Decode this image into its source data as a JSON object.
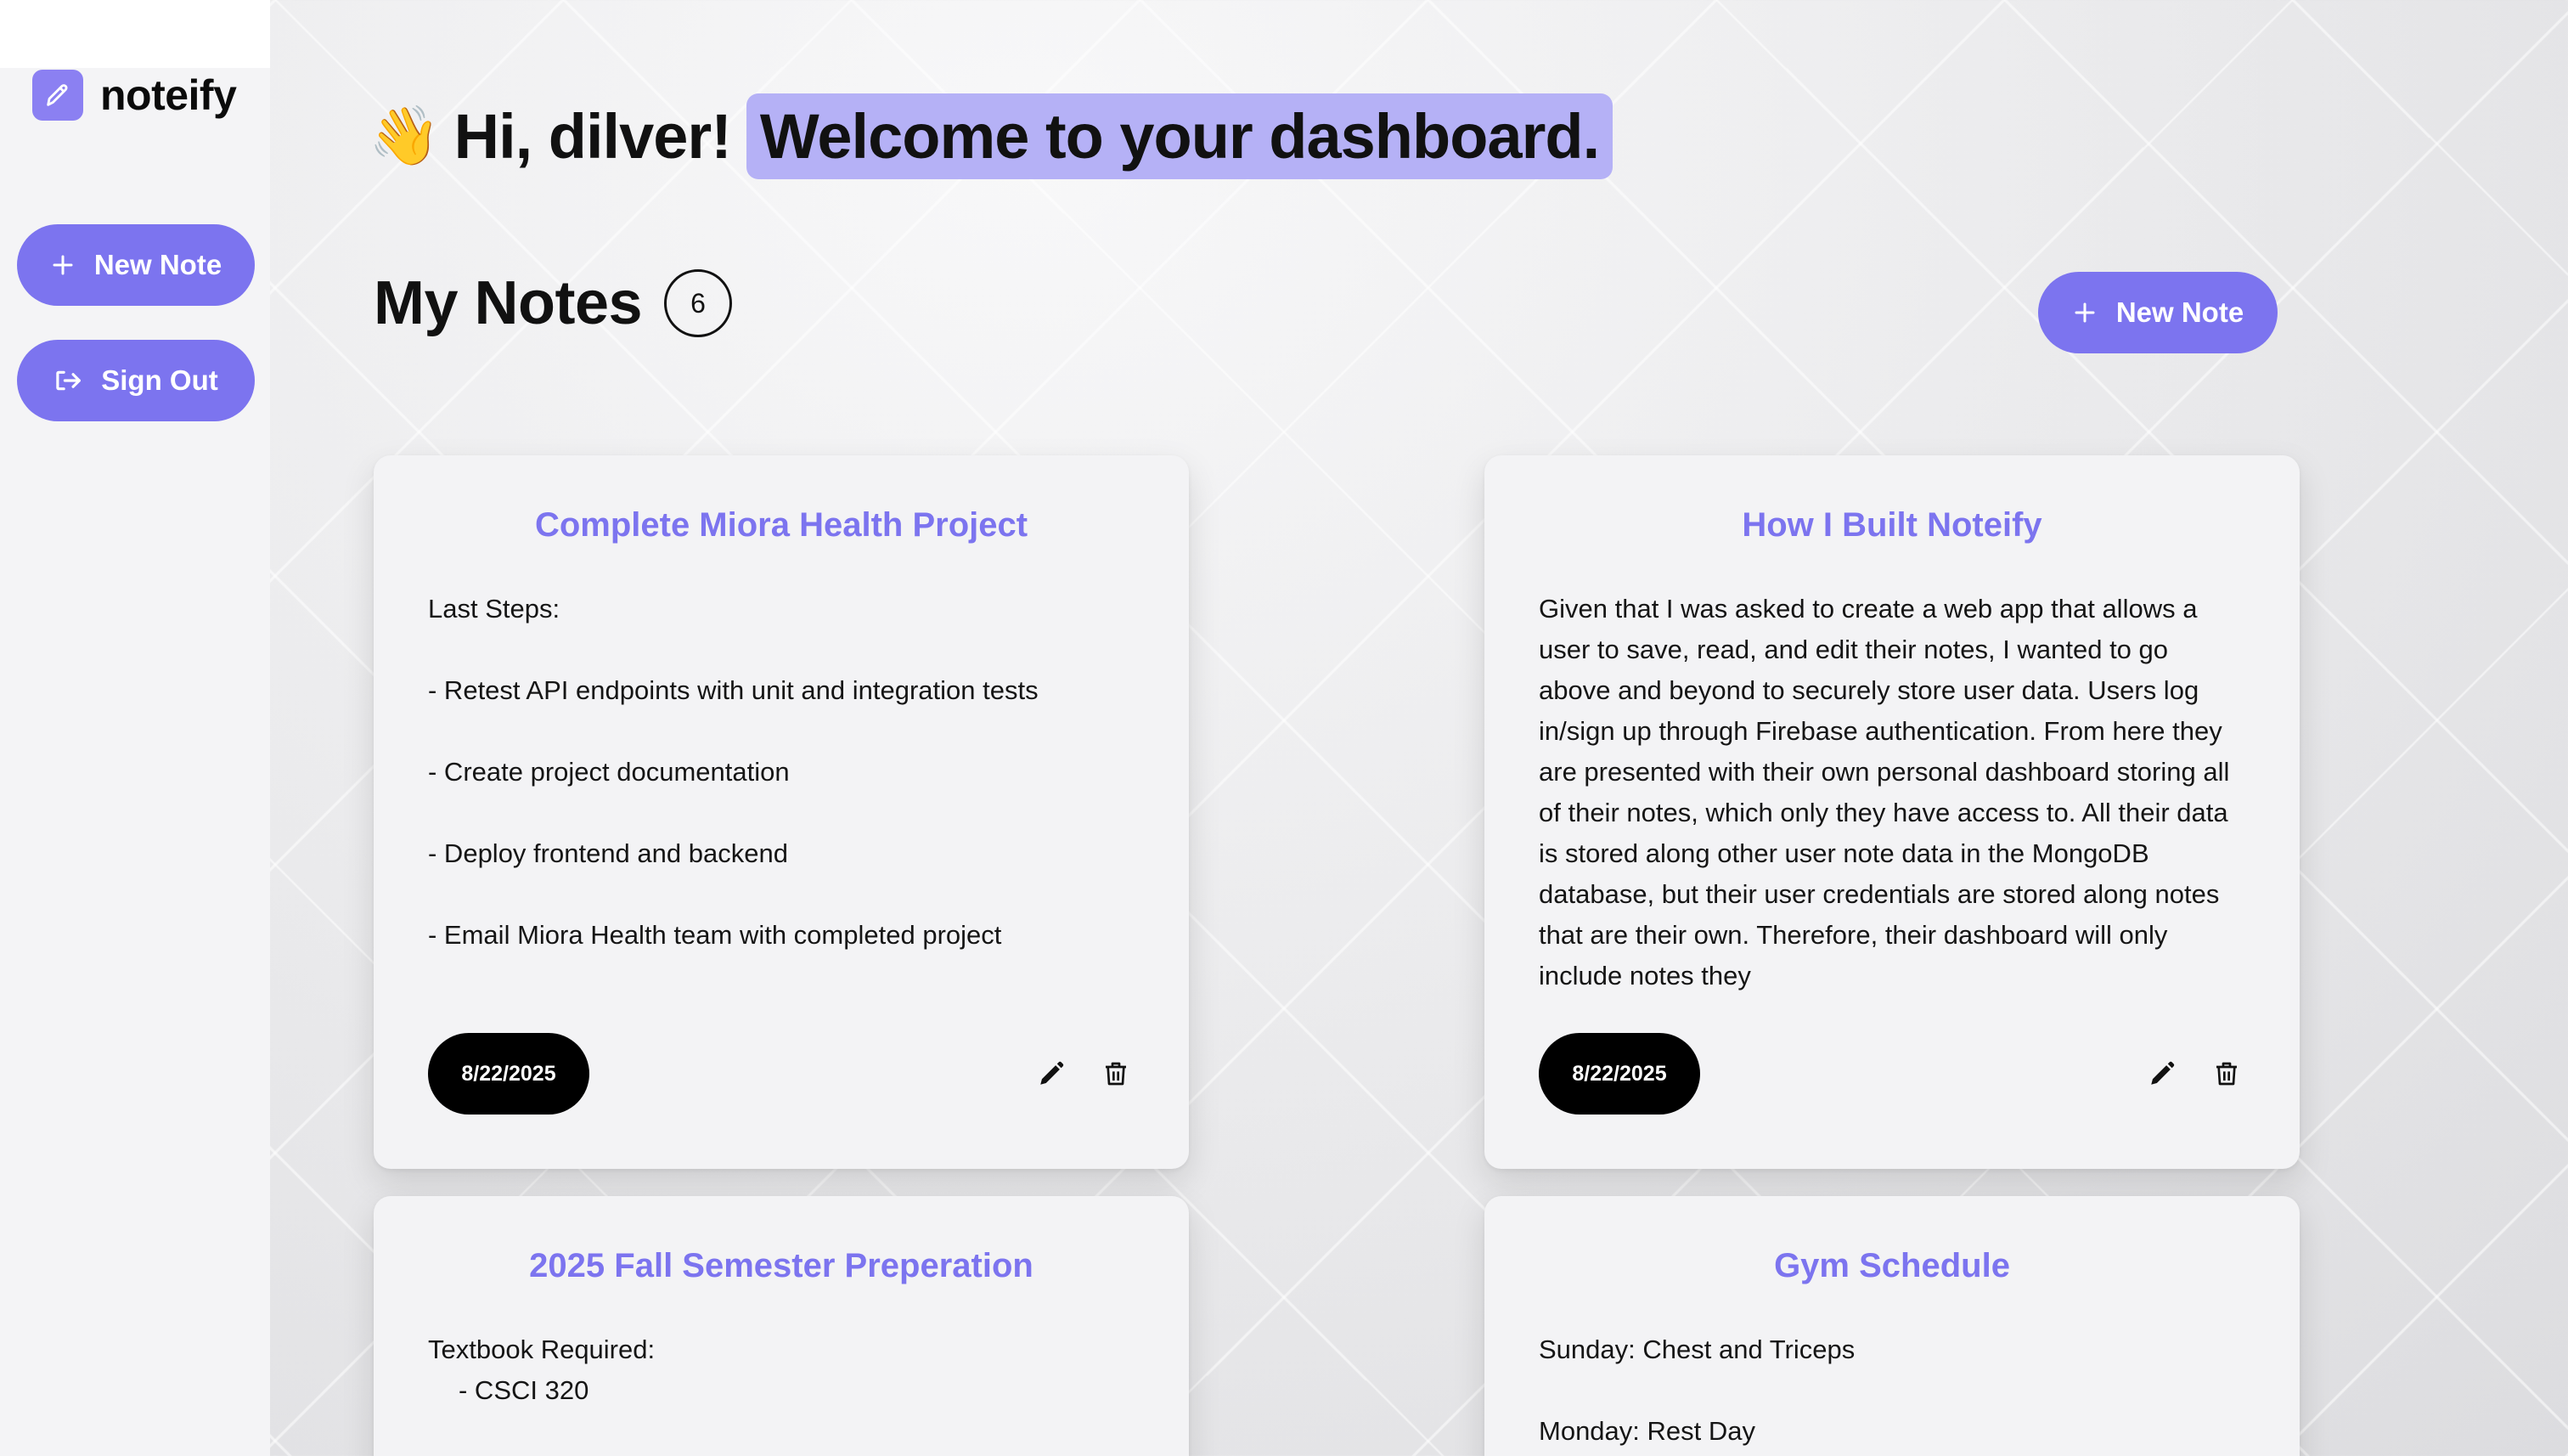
{
  "app": {
    "name": "noteify"
  },
  "sidebar": {
    "new_note_label": "New Note",
    "sign_out_label": "Sign Out"
  },
  "header": {
    "wave_emoji": "👋",
    "greeting": "Hi, dilver!",
    "welcome": "Welcome to your dashboard."
  },
  "notes_section": {
    "title": "My Notes",
    "count": "6",
    "new_note_label": "New Note"
  },
  "notes": [
    {
      "title": "Complete Miora Health Project",
      "lines": [
        "Last Steps:",
        "- Retest API endpoints with unit and integration tests",
        "- Create project documentation",
        "- Deploy frontend and backend",
        "- Email Miora Health team with completed project"
      ],
      "date": "8/22/2025"
    },
    {
      "title": "How I Built Noteify",
      "body": "Given that I was asked to create a web app that allows a user to save, read, and edit their notes, I wanted to go above and beyond to securely store user data. Users log in/sign up through Firebase authentication. From here they are presented with their own personal dashboard storing all of their notes, which only they have access to. All their data is stored along other user note data in the MongoDB database, but their user credentials are stored along notes that are their own. Therefore, their dashboard will only include notes they",
      "date": "8/22/2025"
    },
    {
      "title": "2025 Fall Semester Preperation",
      "lines": [
        "Textbook Required:",
        "- CSCI 320"
      ]
    },
    {
      "title": "Gym Schedule",
      "lines": [
        "Sunday: Chest and Triceps",
        "Monday: Rest Day"
      ]
    }
  ],
  "colors": {
    "accent": "#7c74ef",
    "highlight": "#b5b1f6",
    "date_pill": "#000000"
  },
  "icons": [
    "pencil-icon",
    "plus-icon",
    "sign-out-icon",
    "edit-icon",
    "trash-icon"
  ]
}
